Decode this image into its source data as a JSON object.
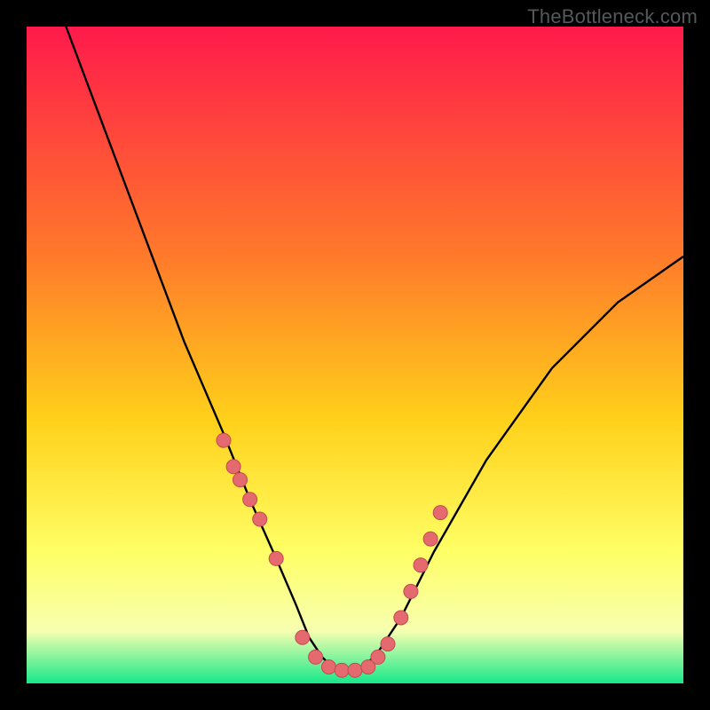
{
  "watermark": "TheBottleneck.com",
  "colors": {
    "bg_black": "#000000",
    "grad_top": "#ff1a4b",
    "grad_mid1": "#ff7a2a",
    "grad_mid2": "#ffd11a",
    "grad_low1": "#ffff66",
    "grad_low2": "#f7ffb0",
    "grad_bottom": "#17e88a",
    "curve": "#000000",
    "dot_fill": "#e46a6f",
    "dot_stroke": "#c44a50"
  },
  "chart_data": {
    "type": "line",
    "title": "",
    "xlabel": "",
    "ylabel": "",
    "xlim": [
      0,
      100
    ],
    "ylim": [
      0,
      100
    ],
    "grid": false,
    "series": [
      {
        "name": "bottleneck-curve",
        "x": [
          0,
          6,
          12,
          18,
          24,
          30,
          34,
          38,
          41,
          43,
          45,
          47,
          50,
          53,
          57,
          62,
          70,
          80,
          90,
          100
        ],
        "values": [
          114,
          100,
          84,
          68,
          52,
          38,
          28,
          19,
          12,
          7,
          4,
          2,
          2,
          4,
          10,
          20,
          34,
          48,
          58,
          65
        ]
      }
    ],
    "points": {
      "name": "highlight-dots",
      "x": [
        30,
        31.5,
        32.5,
        34,
        35.5,
        38,
        42,
        44,
        46,
        48,
        50,
        52,
        53.5,
        55,
        57,
        58.5,
        60,
        61.5,
        63
      ],
      "values": [
        37,
        33,
        31,
        28,
        25,
        19,
        7,
        4,
        2.5,
        2,
        2,
        2.5,
        4,
        6,
        10,
        14,
        18,
        22,
        26
      ]
    }
  }
}
